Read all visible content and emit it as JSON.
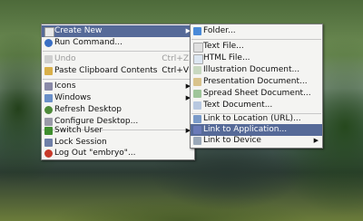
{
  "main_menu": {
    "items": [
      {
        "label": "Create New",
        "shortcut": "",
        "has_submenu": true,
        "highlighted": true,
        "icon": "folder-new-icon",
        "color": "#e8e8e8"
      },
      {
        "label": "Run Command...",
        "shortcut": "",
        "icon": "run-icon",
        "color": "#3a6fc4"
      },
      {
        "label": "Undo",
        "shortcut": "Ctrl+Z",
        "disabled": true,
        "icon": "undo-icon",
        "color": "#cfcfcf"
      },
      {
        "label": "Paste Clipboard Contents",
        "shortcut": "Ctrl+V",
        "icon": "paste-icon",
        "color": "#d9b04a"
      },
      {
        "label": "Icons",
        "has_submenu": true,
        "icon": "icons-icon",
        "color": "#8a8aa8"
      },
      {
        "label": "Windows",
        "has_submenu": true,
        "icon": "windows-icon",
        "color": "#6a8fc8"
      },
      {
        "label": "Refresh Desktop",
        "icon": "refresh-icon",
        "color": "#4e8a3a"
      },
      {
        "label": "Configure Desktop...",
        "icon": "configure-icon",
        "color": "#9a9aa8"
      },
      {
        "label": "Switch User",
        "has_submenu": true,
        "icon": "switch-user-icon",
        "color": "#3f8e2f"
      },
      {
        "label": "Lock Session",
        "icon": "lock-icon",
        "color": "#6f7fa8"
      },
      {
        "label": "Log Out \"embryo\"...",
        "icon": "logout-icon",
        "color": "#c83a2a"
      }
    ]
  },
  "create_new_menu": {
    "items": [
      {
        "label": "Folder...",
        "icon": "folder-icon",
        "color": "#4a8ad8"
      },
      {
        "label": "Text File...",
        "icon": "text-file-icon",
        "color": "#e0e0e0"
      },
      {
        "label": "HTML File...",
        "icon": "html-file-icon",
        "color": "#dde7f2"
      },
      {
        "label": "Illustration Document...",
        "icon": "illustration-icon",
        "color": "#c8d8c0"
      },
      {
        "label": "Presentation Document...",
        "icon": "presentation-icon",
        "color": "#d9c38c"
      },
      {
        "label": "Spread Sheet Document...",
        "icon": "spreadsheet-icon",
        "color": "#9fc59a"
      },
      {
        "label": "Text Document...",
        "icon": "text-document-icon",
        "color": "#b8c8e0"
      },
      {
        "label": "Link to Location (URL)...",
        "icon": "link-url-icon",
        "color": "#7a9ac8"
      },
      {
        "label": "Link to Application...",
        "icon": "link-app-icon",
        "color": "#6a7ab8",
        "highlighted": true
      },
      {
        "label": "Link to Device",
        "icon": "device-icon",
        "color": "#9aa8b8",
        "has_submenu": true
      }
    ]
  }
}
